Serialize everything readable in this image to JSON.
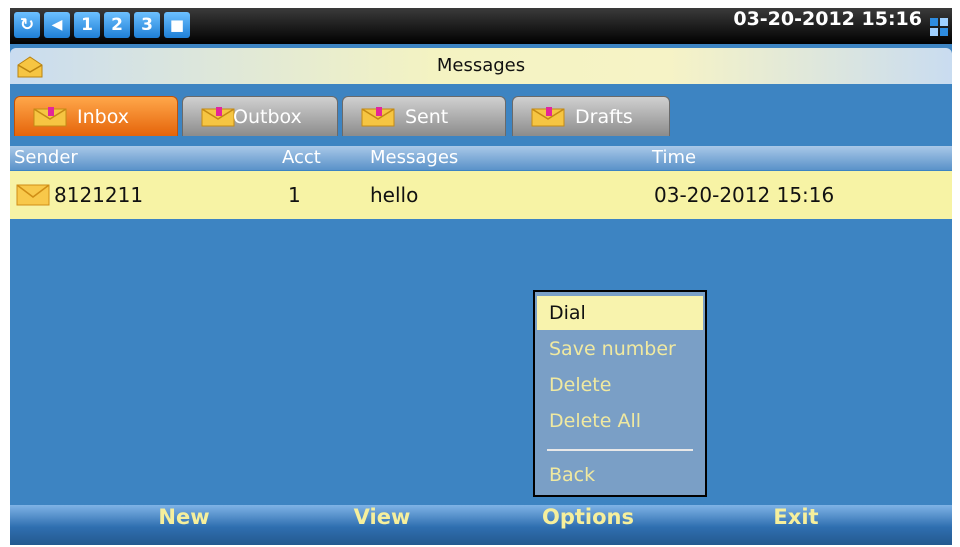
{
  "status_bar": {
    "icons": [
      "sync-icon",
      "volume-icon",
      "1",
      "2",
      "3",
      "sim-icon"
    ],
    "datetime": "03-20-2012 15:16"
  },
  "title": "Messages",
  "tabs": [
    {
      "label": "Inbox",
      "active": true
    },
    {
      "label": "Outbox",
      "active": false
    },
    {
      "label": "Sent",
      "active": false
    },
    {
      "label": "Drafts",
      "active": false
    }
  ],
  "columns": {
    "sender": "Sender",
    "acct": "Acct",
    "messages": "Messages",
    "time": "Time"
  },
  "rows": [
    {
      "sender": "8121211",
      "acct": "1",
      "message": "hello",
      "time": "03-20-2012 15:16"
    }
  ],
  "context_menu": {
    "items": [
      "Dial",
      "Save number",
      "Delete",
      "Delete All",
      "Back"
    ],
    "selected": "Dial"
  },
  "softkeys": [
    "New",
    "View",
    "Options",
    "Exit"
  ],
  "colors": {
    "screen_bg": "#3d84c2",
    "row_highlight": "#f7f3a5",
    "active_tab": "#f07a1c",
    "softkey_text": "#f6ef9c"
  }
}
